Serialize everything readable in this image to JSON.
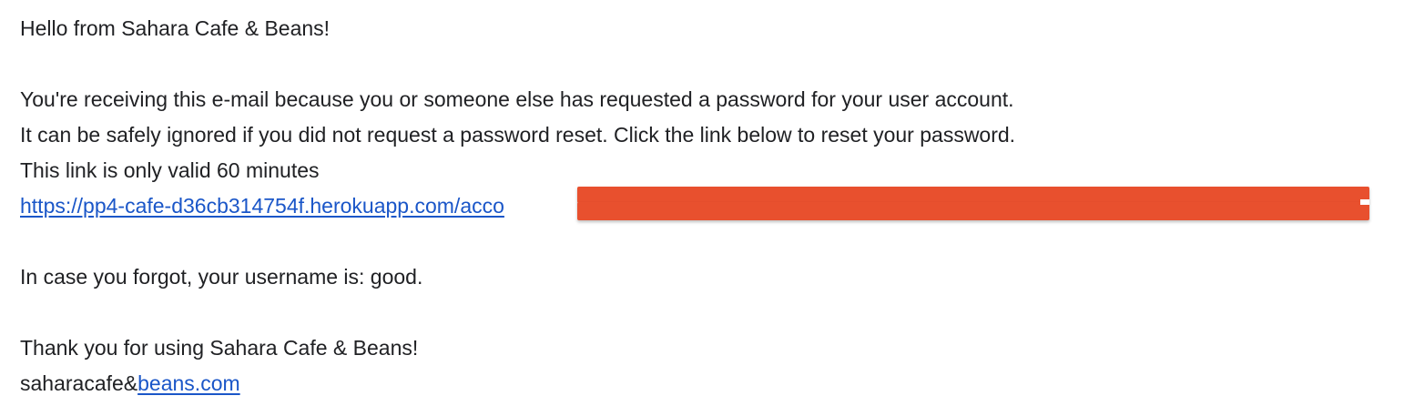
{
  "email": {
    "greeting": "Hello from Sahara Cafe & Beans!",
    "line1": "You're receiving this e-mail because you or someone else has requested a password for your user account.",
    "line2": "It can be safely ignored if you did not request a password reset. Click the link below to reset your password.",
    "line3": "This link is only valid 60 minutes",
    "reset_link_visible": "https://pp4-cafe-d36cb314754f.herokuapp.com/acco",
    "username_line": "In case you forgot, your username is: good.",
    "thanks": "Thank you for using Sahara Cafe & Beans!",
    "signature_prefix": "saharacafe&",
    "signature_link": "beans.com"
  },
  "colors": {
    "text": "#202124",
    "link": "#1a56c8",
    "redaction": "#e8502e",
    "background": "#ffffff"
  }
}
